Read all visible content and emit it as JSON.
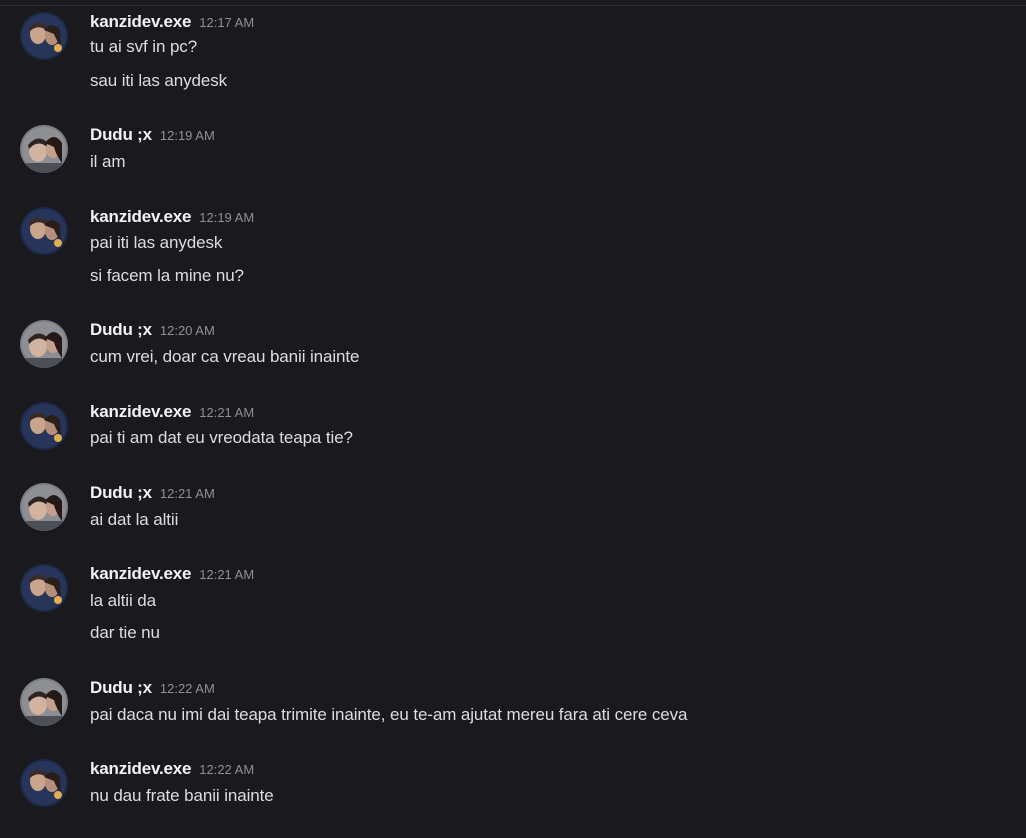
{
  "messages": [
    {
      "author": "kanzidev.exe",
      "time": "12:17 AM",
      "lines": [
        "tu ai svf in pc?",
        "sau iti las anydesk"
      ]
    },
    {
      "author": "Dudu ;x",
      "time": "12:19 AM",
      "lines": [
        "il am"
      ]
    },
    {
      "author": "kanzidev.exe",
      "time": "12:19 AM",
      "lines": [
        "pai iti las anydesk",
        "si facem la mine nu?"
      ]
    },
    {
      "author": "Dudu ;x",
      "time": "12:20 AM",
      "lines": [
        "cum vrei, doar ca vreau banii inainte"
      ]
    },
    {
      "author": "kanzidev.exe",
      "time": "12:21 AM",
      "lines": [
        "pai ti am dat eu vreodata teapa tie?"
      ]
    },
    {
      "author": "Dudu ;x",
      "time": "12:21 AM",
      "lines": [
        "ai dat la altii"
      ]
    },
    {
      "author": "kanzidev.exe",
      "time": "12:21 AM",
      "lines": [
        "la altii da",
        "dar tie nu"
      ]
    },
    {
      "author": "Dudu ;x",
      "time": "12:22 AM",
      "lines": [
        "pai daca nu imi dai teapa trimite inainte, eu te-am ajutat mereu fara ati cere ceva"
      ]
    },
    {
      "author": "kanzidev.exe",
      "time": "12:22 AM",
      "lines": [
        "nu dau frate banii inainte"
      ]
    }
  ],
  "colors": {
    "background": "#1a1a1e",
    "username": "#f2f3f5",
    "timestamp": "#8e9097",
    "message_text": "#dbdee1"
  }
}
